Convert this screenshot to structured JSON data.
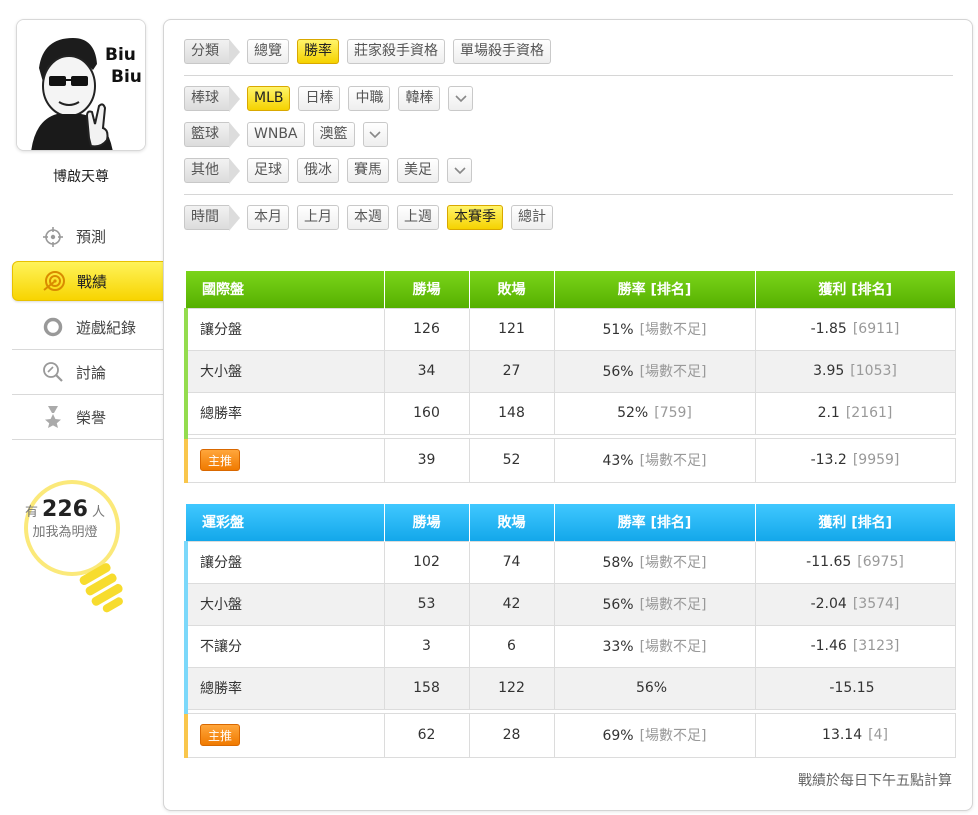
{
  "user": {
    "avatar_caption": "Biu\nBiu",
    "avatar_line1": "Biu",
    "avatar_line2": "Biu",
    "name": "博啟天尊"
  },
  "nav": [
    {
      "label": "預測",
      "icon": "crosshair-icon"
    },
    {
      "label": "戰績",
      "icon": "target-swirl-icon",
      "active": true
    },
    {
      "label": "遊戲紀錄",
      "icon": "ring-icon"
    },
    {
      "label": "討論",
      "icon": "search-pencil-icon"
    },
    {
      "label": "榮譽",
      "icon": "medal-icon"
    }
  ],
  "fans": {
    "prefix": "有",
    "count": "226",
    "suffix": "人",
    "line2": "加我為明燈"
  },
  "filters": {
    "category": {
      "label": "分類",
      "options": [
        "總覽",
        "勝率",
        "莊家殺手資格",
        "單場殺手資格"
      ],
      "selected": "勝率"
    },
    "baseball": {
      "label": "棒球",
      "options": [
        "MLB",
        "日棒",
        "中職",
        "韓棒"
      ],
      "selected": "MLB"
    },
    "basketball": {
      "label": "籃球",
      "options": [
        "WNBA",
        "澳籃"
      ]
    },
    "other": {
      "label": "其他",
      "options": [
        "足球",
        "俄冰",
        "賽馬",
        "美足"
      ]
    },
    "time": {
      "label": "時間",
      "options": [
        "本月",
        "上月",
        "本週",
        "上週",
        "本賽季",
        "總計"
      ],
      "selected": "本賽季"
    }
  },
  "table_intl": {
    "headers": [
      "國際盤",
      "勝場",
      "敗場",
      "勝率 [排名]",
      "獲利 [排名]"
    ],
    "rows": [
      {
        "name": "讓分盤",
        "win": "126",
        "lose": "121",
        "rate": "51%",
        "rate_rank": "[場數不足]",
        "profit": "-1.85",
        "profit_rank": "[6911]"
      },
      {
        "name": "大小盤",
        "win": "34",
        "lose": "27",
        "rate": "56%",
        "rate_rank": "[場數不足]",
        "profit": "3.95",
        "profit_rank": "[1053]"
      },
      {
        "name": "總勝率",
        "win": "160",
        "lose": "148",
        "rate": "52%",
        "rate_rank": "[759]",
        "profit": "2.1",
        "profit_rank": "[2161]"
      }
    ],
    "pick": {
      "badge": "主推",
      "win": "39",
      "lose": "52",
      "rate": "43%",
      "rate_rank": "[場數不足]",
      "profit": "-13.2",
      "profit_rank": "[9959]"
    }
  },
  "table_sports": {
    "headers": [
      "運彩盤",
      "勝場",
      "敗場",
      "勝率 [排名]",
      "獲利 [排名]"
    ],
    "rows": [
      {
        "name": "讓分盤",
        "win": "102",
        "lose": "74",
        "rate": "58%",
        "rate_rank": "[場數不足]",
        "profit": "-11.65",
        "profit_rank": "[6975]"
      },
      {
        "name": "大小盤",
        "win": "53",
        "lose": "42",
        "rate": "56%",
        "rate_rank": "[場數不足]",
        "profit": "-2.04",
        "profit_rank": "[3574]"
      },
      {
        "name": "不讓分",
        "win": "3",
        "lose": "6",
        "rate": "33%",
        "rate_rank": "[場數不足]",
        "profit": "-1.46",
        "profit_rank": "[3123]"
      },
      {
        "name": "總勝率",
        "win": "158",
        "lose": "122",
        "rate": "56%",
        "rate_rank": "",
        "profit": "-15.15",
        "profit_rank": ""
      }
    ],
    "pick": {
      "badge": "主推",
      "win": "62",
      "lose": "28",
      "rate": "69%",
      "rate_rank": "[場數不足]",
      "profit": "13.14",
      "profit_rank": "[4]"
    }
  },
  "footnote": "戰績於每日下午五點計算",
  "colors": {
    "accent_yellow": "#f7d400",
    "green_header": "#55b000",
    "blue_header": "#13a7ea",
    "pick_badge": "#f07a00"
  }
}
